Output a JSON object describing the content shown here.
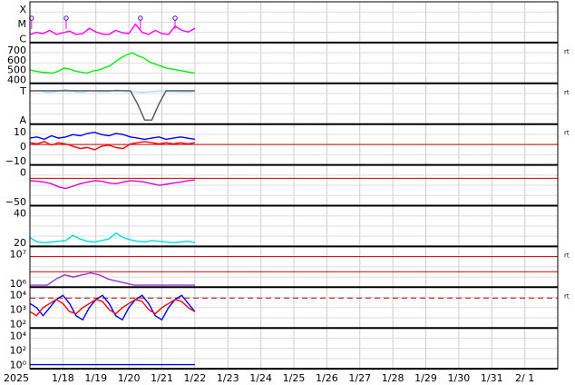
{
  "chart_data": {
    "type": "line",
    "title": "",
    "x_ticks": [
      "2025",
      "1/18",
      "1/19",
      "1/20",
      "1/21",
      "1/22",
      "1/23",
      "1/24",
      "1/25",
      "1/26",
      "1/27",
      "1/28",
      "1/29",
      "1/30",
      "1/31",
      "2/ 1"
    ],
    "x_range_days": [
      0,
      16
    ],
    "data_end_day": 5.0,
    "grid": true,
    "panels": [
      {
        "id": "xray-class",
        "y_tick_labels": [
          "X",
          "M",
          "C"
        ],
        "right_marker": "",
        "series": [
          {
            "color": "#ff00ff",
            "values": [
              0.2,
              0.25,
              0.22,
              0.3,
              0.2,
              0.24,
              0.28,
              0.2,
              0.22,
              0.35,
              0.26,
              0.21,
              0.2,
              0.3,
              0.24,
              0.22,
              0.45,
              0.25,
              0.2,
              0.3,
              0.22,
              0.2,
              0.4,
              0.3,
              0.26,
              0.35
            ]
          }
        ],
        "events_days": [
          0.05,
          1.1,
          3.35,
          4.4
        ]
      },
      {
        "id": "solar-wind-speed",
        "y_tick_labels": [
          "700",
          "600",
          "500",
          "400"
        ],
        "y_range": [
          350,
          750
        ],
        "right_marker": "rt",
        "series": [
          {
            "color": "#00ee00",
            "values": [
              480,
              470,
              460,
              455,
              450,
              470,
              500,
              490,
              470,
              460,
              450,
              470,
              480,
              500,
              520,
              560,
              600,
              630,
              650,
              620,
              600,
              560,
              540,
              520,
              500,
              490,
              480,
              470,
              460,
              450
            ]
          }
        ]
      },
      {
        "id": "imf-direction",
        "y_tick_labels": [
          "T",
          "A"
        ],
        "right_marker": "rt",
        "series": [
          {
            "color": "#aaddff",
            "values": [
              0.8,
              0.82,
              0.78,
              0.8,
              0.85,
              0.8,
              0.78,
              0.82,
              0.8,
              0.8,
              0.84,
              0.8,
              0.8,
              0.78,
              0.8,
              0.82,
              0.8,
              0.8,
              0.79,
              0.8
            ]
          },
          {
            "color": "#555555",
            "values": [
              0.82,
              0.82,
              0.82,
              0.82,
              0.82,
              0.82,
              0.82,
              0.82,
              0.82,
              0.82,
              0.82,
              0.82,
              0.82,
              0.82,
              0.82,
              0.5,
              0.1,
              0.1,
              0.5,
              0.82,
              0.82,
              0.82,
              0.82,
              0.82
            ]
          }
        ]
      },
      {
        "id": "imf-bz",
        "y_tick_labels": [
          "10",
          "0",
          "−10"
        ],
        "y_range": [
          -20,
          15
        ],
        "right_marker": "rt",
        "series": [
          {
            "color": "#0000ff",
            "values": [
              3,
              4,
              2,
              5,
              3,
              4,
              6,
              5,
              7,
              8,
              6,
              5,
              7,
              6,
              4,
              3,
              2,
              3,
              4,
              2,
              3,
              4,
              3,
              2
            ]
          },
          {
            "color": "#ff0000",
            "values": [
              -1,
              -2,
              0,
              -3,
              -1,
              -2,
              -4,
              -6,
              -5,
              -7,
              -4,
              -3,
              -5,
              -6,
              -2,
              -1,
              0,
              -1,
              -2,
              -1,
              -2,
              -1,
              -2,
              -1
            ]
          }
        ]
      },
      {
        "id": "dst-index",
        "y_tick_labels": [
          "0",
          "−50"
        ],
        "y_range": [
          -90,
          40
        ],
        "right_marker": "",
        "series": [
          {
            "color": "#dd00dd",
            "values": [
              -10,
              -12,
              -15,
              -20,
              -30,
              -35,
              -28,
              -20,
              -15,
              -10,
              -12,
              -18,
              -20,
              -15,
              -10,
              -12,
              -15,
              -20,
              -25,
              -22,
              -18,
              -15,
              -10,
              -8
            ]
          }
        ]
      },
      {
        "id": "kp-index",
        "y_tick_labels": [
          "40",
          "20"
        ],
        "y_range": [
          0,
          55
        ],
        "right_marker": "",
        "series": [
          {
            "color": "#00dddd",
            "values": [
              12,
              6,
              5,
              6,
              7,
              8,
              15,
              10,
              7,
              6,
              8,
              10,
              18,
              12,
              9,
              7,
              6,
              8,
              7,
              6,
              5,
              6,
              7,
              5
            ]
          }
        ]
      },
      {
        "id": "proton-flux",
        "y_tick_labels": [
          "10⁷",
          "10⁶"
        ],
        "right_marker": "rt",
        "series": [
          {
            "color": "#9933cc",
            "values": [
              0.05,
              0.05,
              0.05,
              0.2,
              0.3,
              0.25,
              0.3,
              0.35,
              0.3,
              0.2,
              0.15,
              0.1,
              0.05,
              0.05,
              0.05,
              0.05,
              0.05,
              0.05,
              0.05,
              0.05
            ]
          }
        ]
      },
      {
        "id": "electron-flux",
        "y_tick_labels": [
          "10⁴",
          "10³",
          "10²"
        ],
        "right_marker": "rt",
        "threshold_label": "",
        "series": [
          {
            "color": "#0000ff",
            "values": [
              0.6,
              0.5,
              0.3,
              0.5,
              0.7,
              0.8,
              0.6,
              0.3,
              0.2,
              0.5,
              0.7,
              0.8,
              0.6,
              0.3,
              0.2,
              0.5,
              0.7,
              0.8,
              0.6,
              0.3,
              0.2,
              0.5,
              0.7,
              0.8,
              0.6,
              0.4
            ]
          },
          {
            "color": "#ff0000",
            "values": [
              0.4,
              0.3,
              0.5,
              0.6,
              0.7,
              0.6,
              0.4,
              0.35,
              0.5,
              0.6,
              0.7,
              0.65,
              0.45,
              0.35,
              0.5,
              0.6,
              0.7,
              0.65,
              0.45,
              0.35,
              0.5,
              0.6,
              0.7,
              0.65,
              0.5,
              0.4
            ]
          }
        ]
      },
      {
        "id": "neutron",
        "y_tick_labels": [
          "10⁴",
          "10²",
          "10⁰"
        ],
        "right_marker": "",
        "series": [
          {
            "color": "#0000ff",
            "values": [
              0.1,
              0.1,
              0.1,
              0.1,
              0.1,
              0.1,
              0.1,
              0.1,
              0.1,
              0.1,
              0.1,
              0.1
            ]
          }
        ]
      }
    ]
  }
}
